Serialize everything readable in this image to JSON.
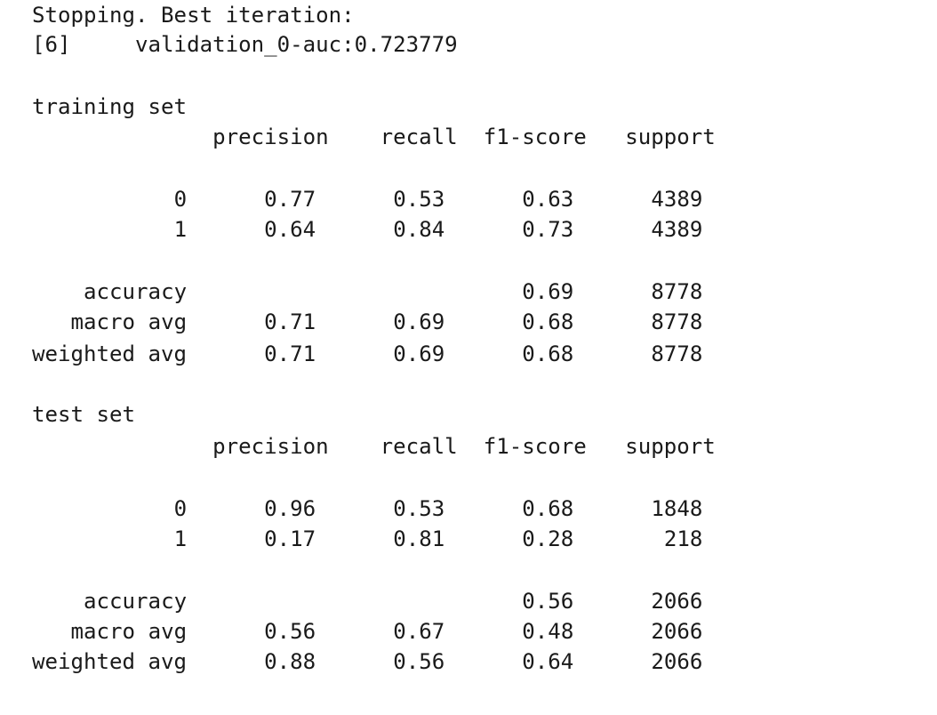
{
  "output": {
    "stopping_line": "Stopping. Best iteration:",
    "best_iteration_line": "[6]\tvalidation_0-auc:0.723779",
    "header_row": "              precision    recall  f1-score   support",
    "sections": [
      {
        "title": "training set",
        "rows": [
          {
            "label": "0",
            "precision": "0.77",
            "recall": "0.53",
            "f1_score": "0.63",
            "support": "4389"
          },
          {
            "label": "1",
            "precision": "0.64",
            "recall": "0.84",
            "f1_score": "0.73",
            "support": "4389"
          },
          {
            "label": "accuracy",
            "precision": "",
            "recall": "",
            "f1_score": "0.69",
            "support": "8778"
          },
          {
            "label": "macro avg",
            "precision": "0.71",
            "recall": "0.69",
            "f1_score": "0.68",
            "support": "8778"
          },
          {
            "label": "weighted avg",
            "precision": "0.71",
            "recall": "0.69",
            "f1_score": "0.68",
            "support": "8778"
          }
        ]
      },
      {
        "title": "test set",
        "rows": [
          {
            "label": "0",
            "precision": "0.96",
            "recall": "0.53",
            "f1_score": "0.68",
            "support": "1848"
          },
          {
            "label": "1",
            "precision": "0.17",
            "recall": "0.81",
            "f1_score": "0.28",
            "support": "218"
          },
          {
            "label": "accuracy",
            "precision": "",
            "recall": "",
            "f1_score": "0.56",
            "support": "2066"
          },
          {
            "label": "macro avg",
            "precision": "0.56",
            "recall": "0.67",
            "f1_score": "0.48",
            "support": "2066"
          },
          {
            "label": "weighted avg",
            "precision": "0.88",
            "recall": "0.56",
            "f1_score": "0.64",
            "support": "2066"
          }
        ]
      }
    ]
  }
}
